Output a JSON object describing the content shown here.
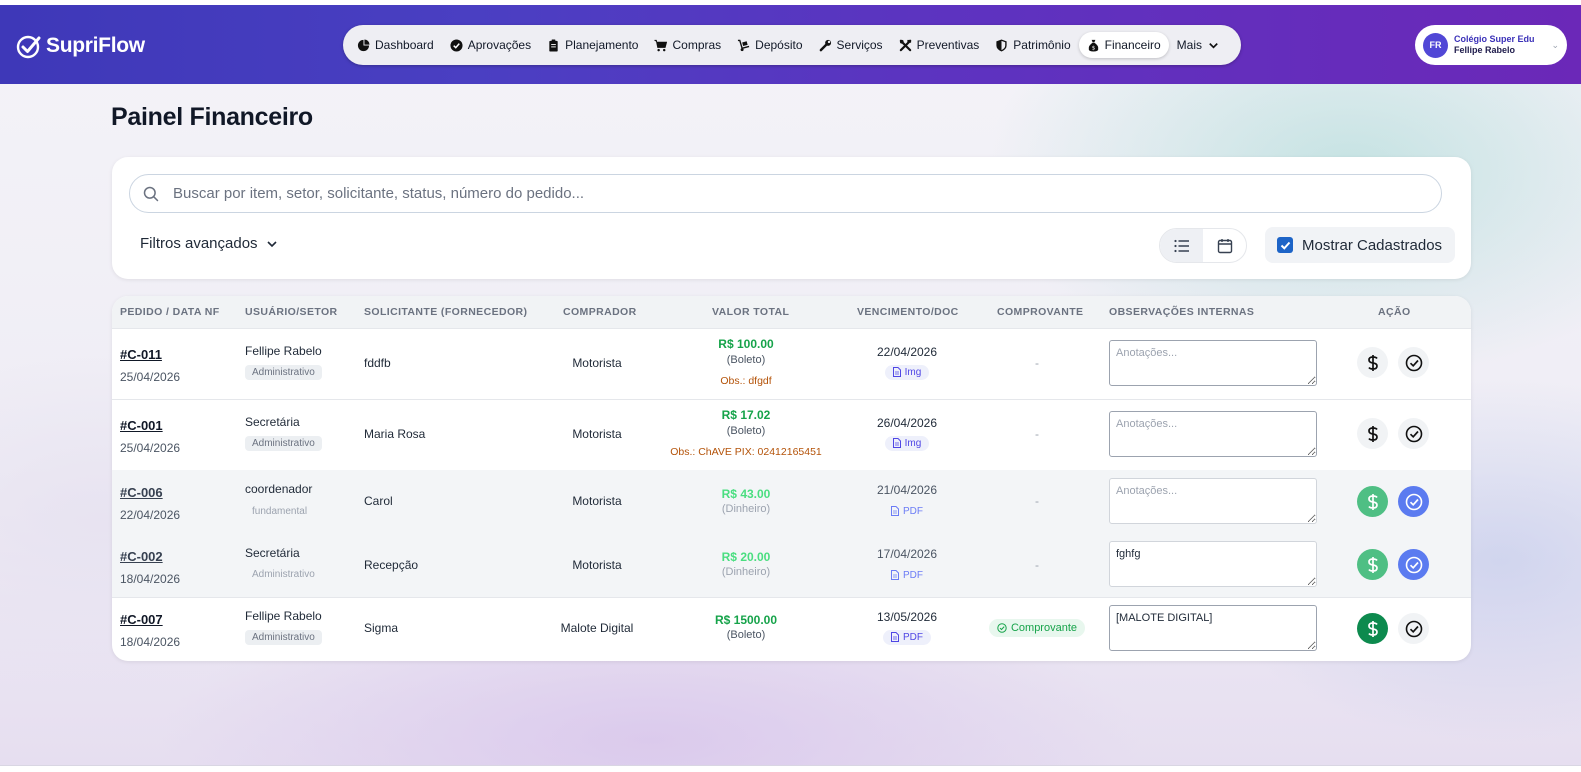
{
  "app": {
    "name": "SupriFlow"
  },
  "nav": {
    "items": [
      {
        "label": "Dashboard",
        "icon": "chart-pie-icon",
        "active": false
      },
      {
        "label": "Aprovações",
        "icon": "check-circle-icon",
        "active": false
      },
      {
        "label": "Planejamento",
        "icon": "clipboard-icon",
        "active": false
      },
      {
        "label": "Compras",
        "icon": "cart-icon",
        "active": false
      },
      {
        "label": "Depósito",
        "icon": "dolly-icon",
        "active": false
      },
      {
        "label": "Serviços",
        "icon": "wrench-icon",
        "active": false
      },
      {
        "label": "Preventivas",
        "icon": "tools-icon",
        "active": false
      },
      {
        "label": "Patrimônio",
        "icon": "shield-icon",
        "active": false
      },
      {
        "label": "Financeiro",
        "icon": "money-bag-icon",
        "active": true
      }
    ],
    "more_label": "Mais"
  },
  "user": {
    "initials": "FR",
    "org": "Colégio Super Edu",
    "name": "Fellipe Rabelo"
  },
  "page": {
    "title": "Painel Financeiro"
  },
  "filters": {
    "search_placeholder": "Buscar por item, setor, solicitante, status, número do pedido...",
    "advanced_label": "Filtros avançados",
    "show_registered_label": "Mostrar Cadastrados",
    "show_registered_checked": true,
    "view_mode": "list"
  },
  "table": {
    "columns": [
      "PEDIDO / DATA NF",
      "USUÁRIO/SETOR",
      "SOLICITANTE (FORNECEDOR)",
      "COMPRADOR",
      "VALOR TOTAL",
      "VENCIMENTO/DOC",
      "COMPROVANTE",
      "OBSERVAÇÕES INTERNAS",
      "AÇÃO"
    ],
    "notes_placeholder": "Anotações...",
    "rows": [
      {
        "id": "#C-011",
        "date": "25/04/2026",
        "user": "Fellipe Rabelo",
        "sector": "Administrativo",
        "requester": "fddfb",
        "buyer": "Motorista",
        "value": "R$ 100.00",
        "payment": "(Boleto)",
        "obs": "Obs.: dfgdf",
        "due": "22/04/2026",
        "doc": "Img",
        "proof": "-",
        "notes": "",
        "registered": false
      },
      {
        "id": "#C-001",
        "date": "25/04/2026",
        "user": "Secretária",
        "sector": "Administrativo",
        "requester": "Maria Rosa",
        "buyer": "Motorista",
        "value": "R$ 17.02",
        "payment": "(Boleto)",
        "obs": "Obs.: ChAVE PIX: 02412165451",
        "due": "26/04/2026",
        "doc": "Img",
        "proof": "-",
        "notes": "",
        "registered": false
      },
      {
        "id": "#C-006",
        "date": "22/04/2026",
        "user": "coordenador",
        "sector": "fundamental",
        "requester": "Carol",
        "buyer": "Motorista",
        "value": "R$ 43.00",
        "payment": "(Dinheiro)",
        "obs": "",
        "due": "21/04/2026",
        "doc": "PDF",
        "proof": "-",
        "notes": "",
        "registered": true
      },
      {
        "id": "#C-002",
        "date": "18/04/2026",
        "user": "Secretária",
        "sector": "Administrativo",
        "requester": "Recepção",
        "buyer": "Motorista",
        "value": "R$ 20.00",
        "payment": "(Dinheiro)",
        "obs": "",
        "due": "17/04/2026",
        "doc": "PDF",
        "proof": "-",
        "notes": "fghfg",
        "registered": true
      },
      {
        "id": "#C-007",
        "date": "18/04/2026",
        "user": "Fellipe Rabelo",
        "sector": "Administrativo",
        "requester": "Sigma",
        "buyer": "Malote Digital",
        "value": "R$ 1500.00",
        "payment": "(Boleto)",
        "obs": "",
        "due": "13/05/2026",
        "doc": "PDF",
        "proof": "Comprovante",
        "notes": "[MALOTE DIGITAL]",
        "registered": false
      }
    ]
  },
  "colors": {
    "brand": "#4a3fc2",
    "accent": "#6b28b8",
    "success": "#16a34a",
    "link": "#4f46e5"
  }
}
